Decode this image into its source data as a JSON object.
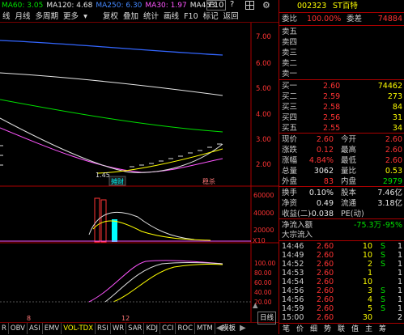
{
  "topbar": {
    "ma": [
      {
        "label": "MA60: 3.05",
        "color": "#00e000"
      },
      {
        "label": "MA120: 4.68",
        "color": "#e8e8e8"
      },
      {
        "label": "MA250: 6.30",
        "color": "#4488ff"
      },
      {
        "label": "MA30: 1.97",
        "color": "#ff55ff"
      },
      {
        "label": "MA453:",
        "color": "#e8e8e8"
      }
    ],
    "buttons": [
      "F10",
      "?"
    ],
    "icons": [
      "grid-icon",
      "gear-icon"
    ]
  },
  "toolbar2": {
    "tabs": [
      "线",
      "月线",
      "多周期",
      "更多"
    ],
    "buttons": [
      "复权",
      "叠加",
      "统计",
      "画线",
      "F10",
      "标记",
      "",
      "返回"
    ]
  },
  "chart_axis": {
    "price_ticks": [
      "7.00",
      "6.00",
      "5.00",
      "4.00",
      "3.00",
      "2.00"
    ],
    "volume_ticks": [
      "60000",
      "40000",
      "20000"
    ],
    "volume_unit": "X10",
    "ind_ticks": [
      "100.00",
      "80.00",
      "60.00",
      "40.00",
      "20.00"
    ],
    "low_label": "1.45",
    "markers": {
      "m1": "摊财",
      "m2": "研报",
      "m3": "稳杀"
    },
    "date_marks": [
      "8",
      "12"
    ]
  },
  "bottom_tabs": [
    "R",
    "OBV",
    "ASI",
    "EMV",
    "VOL-TDX",
    "RSI",
    "WR",
    "SAR",
    "KDJ",
    "CCI",
    "ROC",
    "MTM"
  ],
  "bottom_extra": {
    "left_arrow": "◀",
    "mid": "模板",
    "right_arrow": "▶",
    "label": "日线",
    "x2": "▲"
  },
  "stock": {
    "code": "002323",
    "name": "ST百特",
    "weibi_label": "委比",
    "weibi": "100.00%",
    "weicha_label": "委差",
    "weicha": "74884"
  },
  "sells": [
    {
      "label": "卖五",
      "price": "",
      "vol": ""
    },
    {
      "label": "卖四",
      "price": "",
      "vol": ""
    },
    {
      "label": "卖三",
      "price": "",
      "vol": ""
    },
    {
      "label": "卖二",
      "price": "",
      "vol": ""
    },
    {
      "label": "卖一",
      "price": "",
      "vol": ""
    }
  ],
  "buys": [
    {
      "label": "买一",
      "price": "2.60",
      "vol": "74462"
    },
    {
      "label": "买二",
      "price": "2.59",
      "vol": "273"
    },
    {
      "label": "买三",
      "price": "2.58",
      "vol": "84"
    },
    {
      "label": "买四",
      "price": "2.56",
      "vol": "31"
    },
    {
      "label": "买五",
      "price": "2.55",
      "vol": "34"
    }
  ],
  "quote": [
    {
      "l1": "现价",
      "v1": "2.60",
      "c1": "#ff3333",
      "l2": "今开",
      "v2": "2.60",
      "c2": "#ff3333"
    },
    {
      "l1": "涨跌",
      "v1": "0.12",
      "c1": "#ff3333",
      "l2": "最高",
      "v2": "2.60",
      "c2": "#ff3333"
    },
    {
      "l1": "涨幅",
      "v1": "4.84%",
      "c1": "#ff3333",
      "l2": "最低",
      "v2": "2.60",
      "c2": "#ff3333"
    },
    {
      "l1": "总量",
      "v1": "3062",
      "c1": "#e8e8e8",
      "l2": "量比",
      "v2": "0.53",
      "c2": "#ffff00"
    },
    {
      "l1": "外盘",
      "v1": "83",
      "c1": "#ff3333",
      "l2": "内盘",
      "v2": "2979",
      "c2": "#00e000"
    }
  ],
  "stats": [
    {
      "l1": "换手",
      "v1": "0.10%",
      "c1": "#e8e8e8",
      "l2": "股本",
      "v2": "7.46亿",
      "c2": "#e8e8e8"
    },
    {
      "l1": "净资",
      "v1": "0.49",
      "c1": "#e8e8e8",
      "l2": "流通",
      "v2": "3.18亿",
      "c2": "#e8e8e8"
    },
    {
      "l1": "收益(二)",
      "v1": "-0.038",
      "c1": "#e8e8e8",
      "l2": "PE(动)",
      "v2": "",
      "c2": "#e8e8e8"
    }
  ],
  "flow": [
    {
      "label": "净流入额",
      "v1": "-75.3万",
      "v2": "-95%",
      "color": "#00e000"
    },
    {
      "label": "大宗流入",
      "v1": "",
      "v2": "",
      "color": "#e8e8e8"
    }
  ],
  "ticks": [
    {
      "t": "14:46",
      "p": "2.60",
      "v": "10",
      "s": "S",
      "n": "1"
    },
    {
      "t": "14:49",
      "p": "2.60",
      "v": "10",
      "s": "S",
      "n": "1"
    },
    {
      "t": "14:52",
      "p": "2.60",
      "v": "2",
      "s": "S",
      "n": "1"
    },
    {
      "t": "14:53",
      "p": "2.60",
      "v": "1",
      "s": "",
      "n": "1"
    },
    {
      "t": "14:54",
      "p": "2.60",
      "v": "10",
      "s": "",
      "n": "1"
    },
    {
      "t": "14:56",
      "p": "2.60",
      "v": "3",
      "s": "S",
      "n": "1"
    },
    {
      "t": "14:56",
      "p": "2.60",
      "v": "4",
      "s": "S",
      "n": "1"
    },
    {
      "t": "14:59",
      "p": "2.60",
      "v": "5",
      "s": "S",
      "n": "1"
    },
    {
      "t": "15:00",
      "p": "2.60",
      "v": "30",
      "s": "",
      "n": "2"
    }
  ],
  "rp_bottom": [
    "笔",
    "价",
    "细",
    "势",
    "联",
    "值",
    "主",
    "筹"
  ]
}
